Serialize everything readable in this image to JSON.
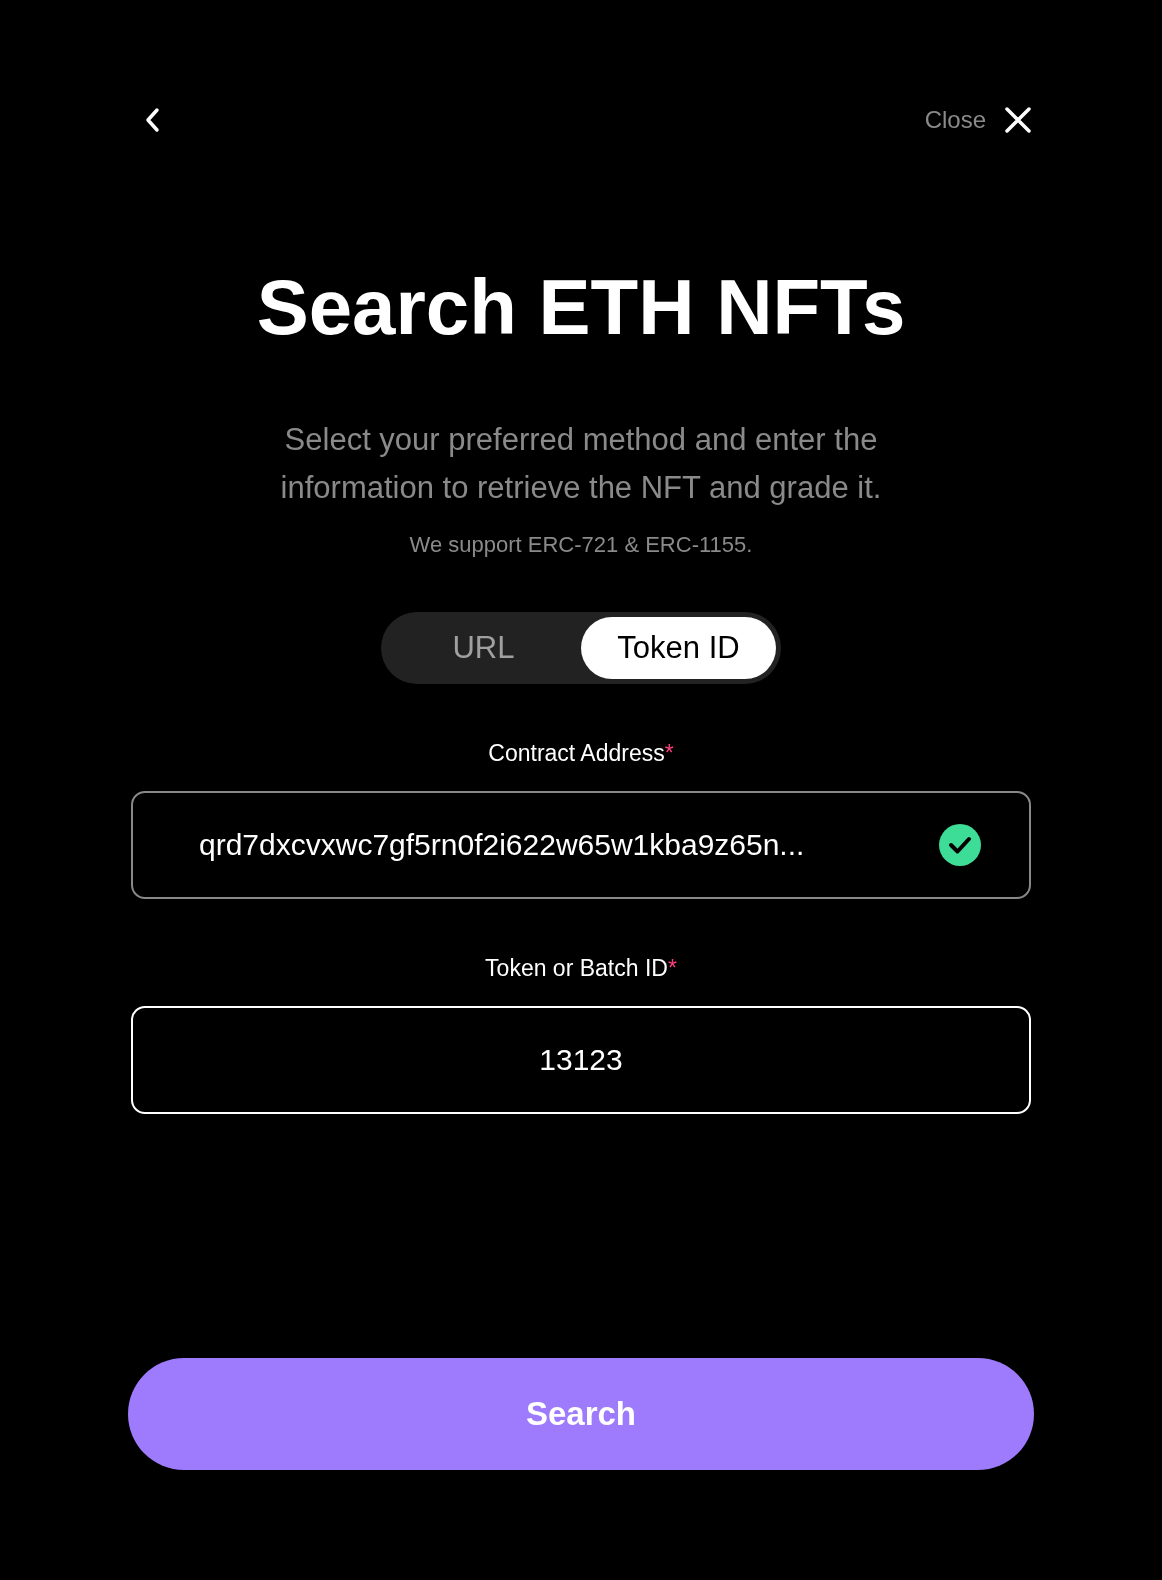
{
  "header": {
    "close_label": "Close"
  },
  "title": "Search ETH NFTs",
  "subtitle": "Select your preferred method and enter the information to retrieve the NFT and grade it.",
  "note": "We support ERC-721 & ERC-1155.",
  "tabs": [
    {
      "label": "URL",
      "selected": false
    },
    {
      "label": "Token ID",
      "selected": true
    }
  ],
  "fields": [
    {
      "label": "Contract Address",
      "required_mark": "*",
      "value": "qrd7dxcvxwc7gf5rn0f2i622w65w1kba9z65n...",
      "valid": true
    },
    {
      "label": "Token or Batch ID",
      "required_mark": "*",
      "value": "13123",
      "valid": false
    }
  ],
  "search_button": "Search"
}
